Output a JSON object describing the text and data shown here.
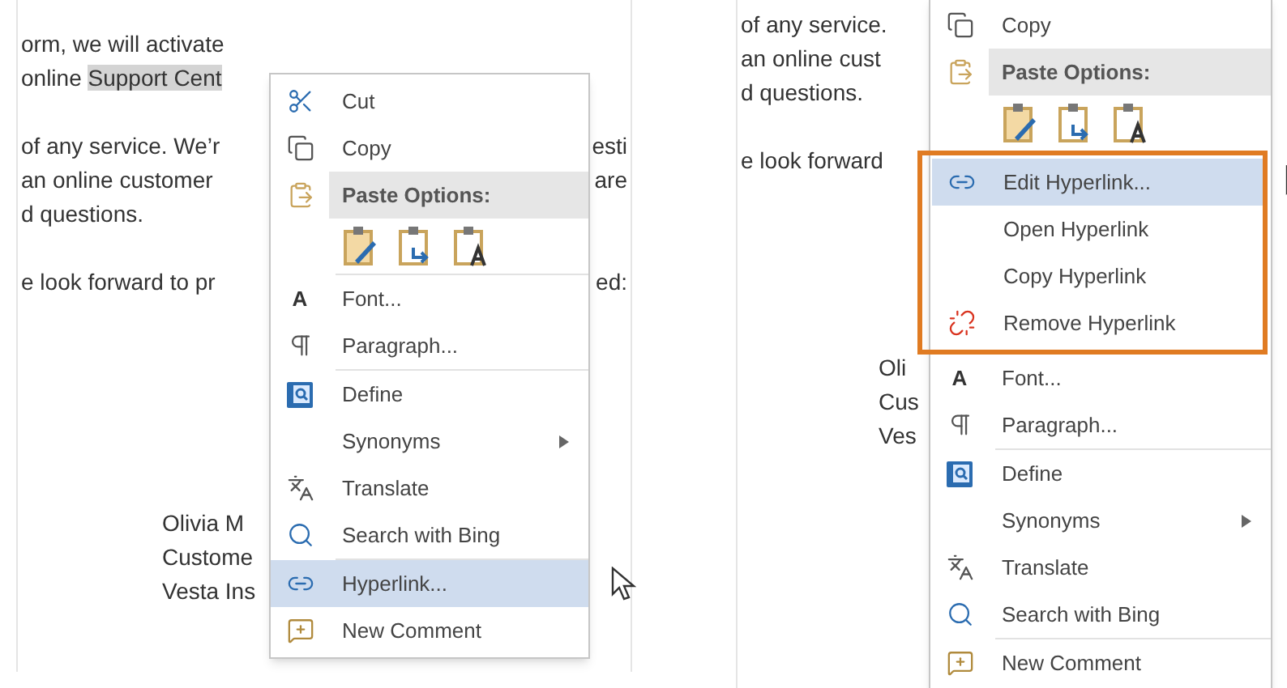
{
  "panels": [
    {
      "document": {
        "paragraphs": [
          {
            "lines": [
              {
                "segments": [
                  {
                    "text": "orm, we will activate",
                    "highlighted": false
                  }
                ]
              },
              {
                "segments": [
                  {
                    "text": "online ",
                    "highlighted": false
                  },
                  {
                    "text": "Support Cent",
                    "highlighted": true
                  }
                ]
              }
            ]
          },
          {
            "lines": [
              {
                "segments": [
                  {
                    "text": "of any service. We’r",
                    "highlighted": false
                  }
                ],
                "right": "esti"
              },
              {
                "segments": [
                  {
                    "text": "an online customer",
                    "highlighted": false
                  }
                ],
                "right": "are"
              },
              {
                "segments": [
                  {
                    "text": "d questions.",
                    "highlighted": false
                  }
                ]
              }
            ]
          },
          {
            "lines": [
              {
                "segments": [
                  {
                    "text": "e look forward to pr",
                    "highlighted": false
                  }
                ],
                "right": "ed:"
              }
            ]
          }
        ],
        "signature": [
          "Olivia M",
          "Custome",
          "Vesta Ins"
        ]
      },
      "menu": {
        "sections": [
          {
            "framed": false,
            "items": [
              {
                "kind": "command",
                "label": "Cut",
                "selected": false,
                "divider": false
              },
              {
                "kind": "command",
                "label": "Copy",
                "selected": false,
                "divider": false
              },
              {
                "kind": "header",
                "label": "Paste Options:",
                "divider": false
              },
              {
                "kind": "paste",
                "divider": true
              },
              {
                "kind": "command",
                "label": "Font...",
                "glyph": "A",
                "selected": false,
                "divider": false
              },
              {
                "kind": "command",
                "label": "Paragraph...",
                "selected": false,
                "divider": true
              },
              {
                "kind": "command",
                "label": "Define",
                "selected": false,
                "divider": false
              },
              {
                "kind": "submenu",
                "label": "Synonyms",
                "selected": false,
                "divider": false
              },
              {
                "kind": "command",
                "label": "Translate",
                "selected": false,
                "divider": false
              },
              {
                "kind": "command",
                "label": "Search with Bing",
                "selected": false,
                "divider": true
              },
              {
                "kind": "command",
                "label": "Hyperlink...",
                "selected": true,
                "divider": false
              },
              {
                "kind": "command",
                "label": "New Comment",
                "selected": false,
                "divider": false
              }
            ]
          }
        ]
      }
    },
    {
      "document": {
        "paragraphs": [
          {
            "lines": [
              {
                "segments": [
                  {
                    "text": "of any service.",
                    "highlighted": false
                  }
                ]
              },
              {
                "segments": [
                  {
                    "text": "an online cust",
                    "highlighted": false
                  }
                ]
              },
              {
                "segments": [
                  {
                    "text": "d questions.",
                    "highlighted": false
                  }
                ]
              }
            ]
          },
          {
            "lines": [
              {
                "segments": [
                  {
                    "text": "e look forward",
                    "highlighted": false
                  }
                ]
              }
            ]
          }
        ],
        "signature": [
          "Oli",
          "Cus",
          "Ves"
        ]
      },
      "menu": {
        "sections": [
          {
            "framed": false,
            "items": [
              {
                "kind": "command",
                "label": "Copy",
                "selected": false,
                "divider": false
              },
              {
                "kind": "header",
                "label": "Paste Options:",
                "divider": false
              },
              {
                "kind": "paste",
                "divider": false
              }
            ]
          },
          {
            "framed": true,
            "items": [
              {
                "kind": "command",
                "label": "Edit Hyperlink...",
                "selected": true,
                "divider": false
              },
              {
                "kind": "command",
                "label": "Open Hyperlink",
                "selected": false,
                "divider": false
              },
              {
                "kind": "command",
                "label": "Copy Hyperlink",
                "selected": false,
                "divider": false
              },
              {
                "kind": "command",
                "label": "Remove Hyperlink",
                "selected": false,
                "divider": false
              }
            ]
          },
          {
            "framed": false,
            "items": [
              {
                "kind": "command",
                "label": "Font...",
                "glyph": "A",
                "selected": false,
                "divider": false
              },
              {
                "kind": "command",
                "label": "Paragraph...",
                "selected": false,
                "divider": true
              },
              {
                "kind": "command",
                "label": "Define",
                "selected": false,
                "divider": false
              },
              {
                "kind": "submenu",
                "label": "Synonyms",
                "selected": false,
                "divider": false
              },
              {
                "kind": "command",
                "label": "Translate",
                "selected": false,
                "divider": false
              },
              {
                "kind": "command",
                "label": "Search with Bing",
                "selected": false,
                "divider": true
              },
              {
                "kind": "command",
                "label": "New Comment",
                "selected": false,
                "divider": false
              }
            ]
          }
        ]
      }
    }
  ]
}
